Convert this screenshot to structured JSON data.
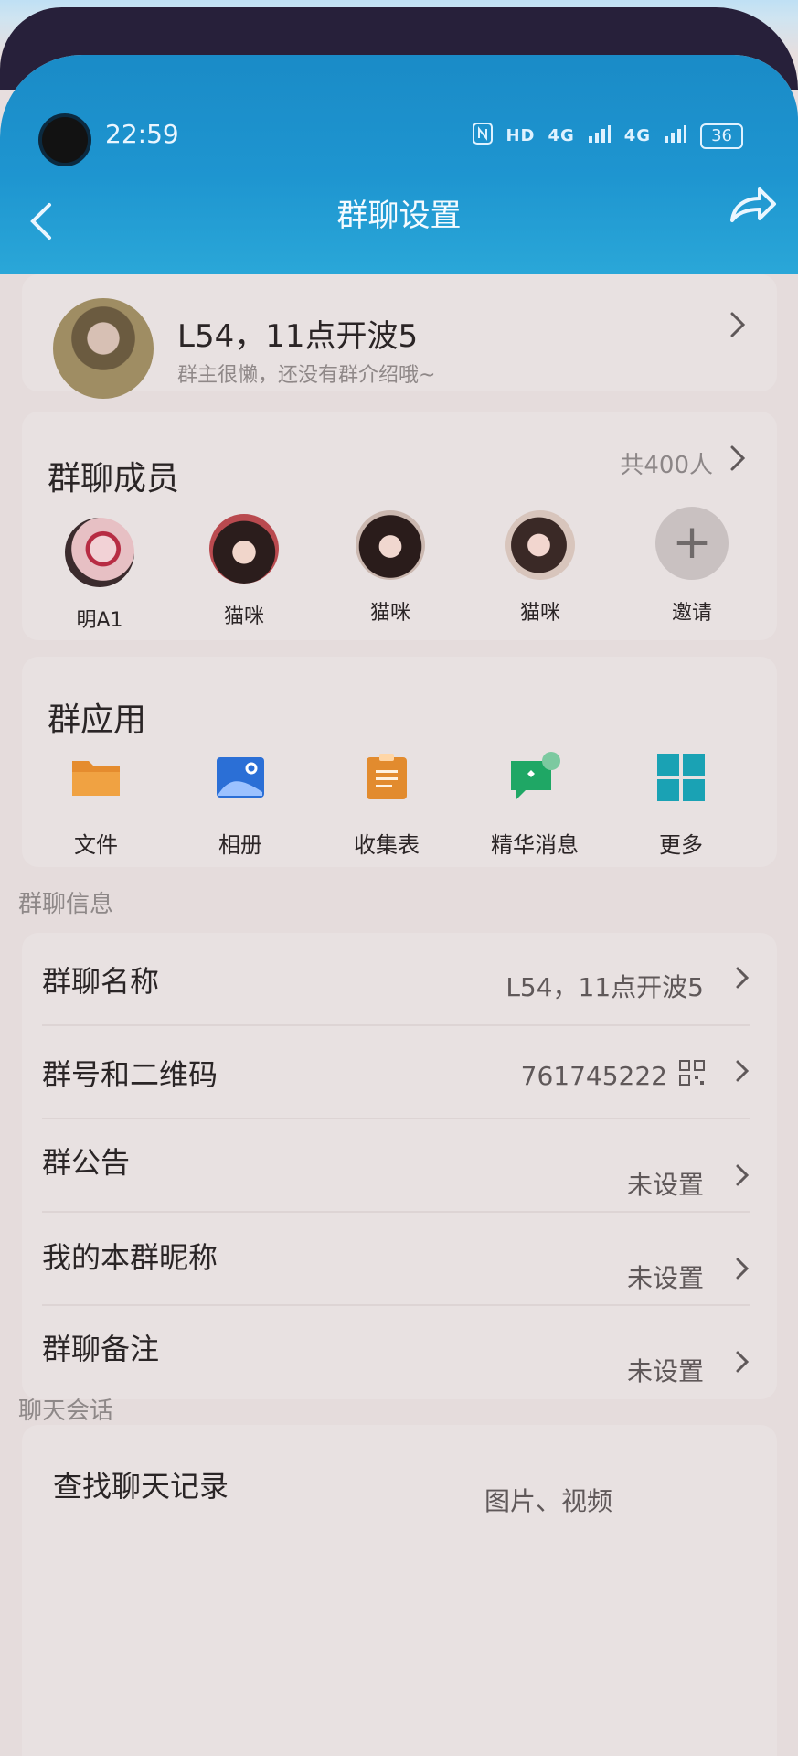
{
  "status": {
    "time": "22:59",
    "battery": "36",
    "hd": "HD",
    "sig1": "4G",
    "sig2": "4G"
  },
  "appbar": {
    "title": "群聊设置"
  },
  "group": {
    "name": "L54，11点开波5",
    "intro": "群主很懒，还没有群介绍哦~"
  },
  "members": {
    "title": "群聊成员",
    "count": "共400人",
    "items": [
      {
        "name": "明A1"
      },
      {
        "name": "猫咪"
      },
      {
        "name": "猫咪"
      },
      {
        "name": "猫咪"
      }
    ],
    "invite": "邀请"
  },
  "apps": {
    "title": "群应用",
    "items": [
      {
        "label": "文件",
        "icon": "folder-icon",
        "color": "#E58C2E"
      },
      {
        "label": "相册",
        "icon": "album-icon",
        "color": "#2B6FD6"
      },
      {
        "label": "收集表",
        "icon": "clipboard-icon",
        "color": "#E28B2E"
      },
      {
        "label": "精华消息",
        "icon": "essence-chat-icon",
        "color": "#1FA765"
      },
      {
        "label": "更多",
        "icon": "more-grid-icon",
        "color": "#1AA2B4"
      }
    ]
  },
  "info": {
    "label": "群聊信息",
    "rows": [
      {
        "key": "群聊名称",
        "value": "L54，11点开波5"
      },
      {
        "key": "群号和二维码",
        "value": "761745222"
      },
      {
        "key": "群公告",
        "value": "未设置"
      },
      {
        "key": "我的本群昵称",
        "value": "未设置"
      },
      {
        "key": "群聊备注",
        "value": "未设置"
      }
    ]
  },
  "chat": {
    "label": "聊天会话",
    "rows": [
      {
        "key": "查找聊天记录",
        "value": "图片、视频"
      }
    ]
  }
}
